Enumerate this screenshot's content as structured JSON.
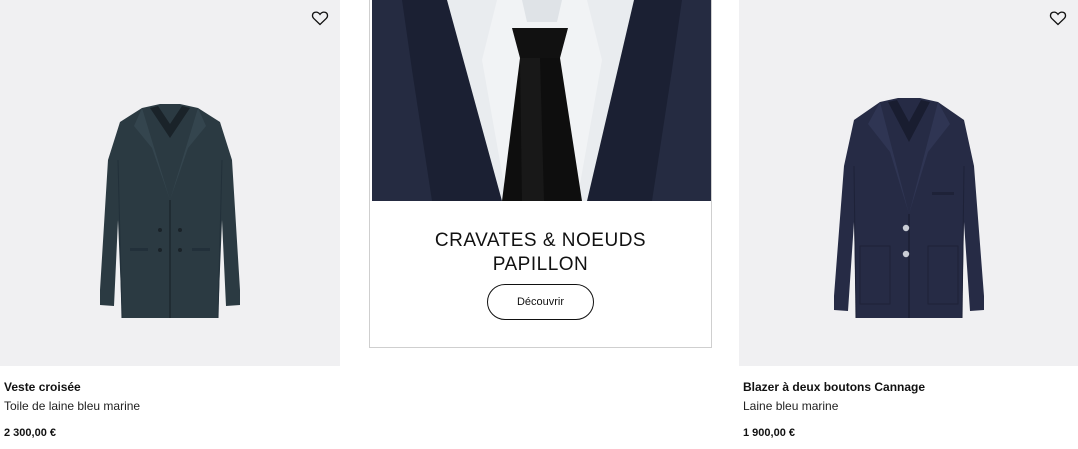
{
  "products": [
    {
      "name": "Veste croisée",
      "description": "Toile de laine bleu marine",
      "price": "2 300,00 €",
      "wishlist_icon": "heart-outline-icon"
    },
    {
      "name": "Blazer à deux boutons Cannage",
      "description": "Laine bleu marine",
      "price": "1 900,00 €",
      "wishlist_icon": "heart-outline-icon"
    }
  ],
  "promo": {
    "title_line1": "CRAVATES & NOEUDS",
    "title_line2": "PAPILLON",
    "button_label": "Découvrir"
  },
  "colors": {
    "tile_bg": "#f0f0f2",
    "jacket_left": "#2b3a42",
    "jacket_right": "#262b45"
  }
}
